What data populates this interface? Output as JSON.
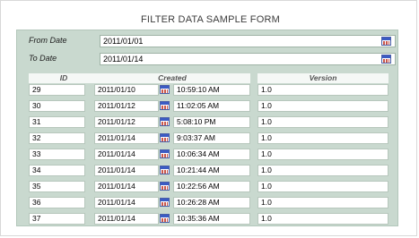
{
  "form": {
    "title": "FILTER DATA SAMPLE FORM",
    "from_label": "From Date",
    "from_value": "2011/01/01",
    "to_label": "To Date",
    "to_value": "2011/01/14"
  },
  "table": {
    "headers": [
      "ID",
      "Created",
      "Version"
    ],
    "rows": [
      {
        "id": "29",
        "date": "2011/01/10",
        "time": "10:59:10 AM",
        "version": "1.0"
      },
      {
        "id": "30",
        "date": "2011/01/12",
        "time": "11:02:05 AM",
        "version": "1.0"
      },
      {
        "id": "31",
        "date": "2011/01/12",
        "time": "5:08:10 PM",
        "version": "1.0"
      },
      {
        "id": "32",
        "date": "2011/01/14",
        "time": "9:03:37 AM",
        "version": "1.0"
      },
      {
        "id": "33",
        "date": "2011/01/14",
        "time": "10:06:34 AM",
        "version": "1.0"
      },
      {
        "id": "34",
        "date": "2011/01/14",
        "time": "10:21:44 AM",
        "version": "1.0"
      },
      {
        "id": "35",
        "date": "2011/01/14",
        "time": "10:22:56 AM",
        "version": "1.0"
      },
      {
        "id": "36",
        "date": "2011/01/14",
        "time": "10:26:28 AM",
        "version": "1.0"
      },
      {
        "id": "37",
        "date": "2011/01/14",
        "time": "10:35:36 AM",
        "version": "1.0"
      }
    ]
  },
  "icons": {
    "date_picker": "calendar-icon"
  },
  "colors": {
    "panel_bg": "#c9d9cf",
    "calendar_header": "#3b5bc4"
  }
}
